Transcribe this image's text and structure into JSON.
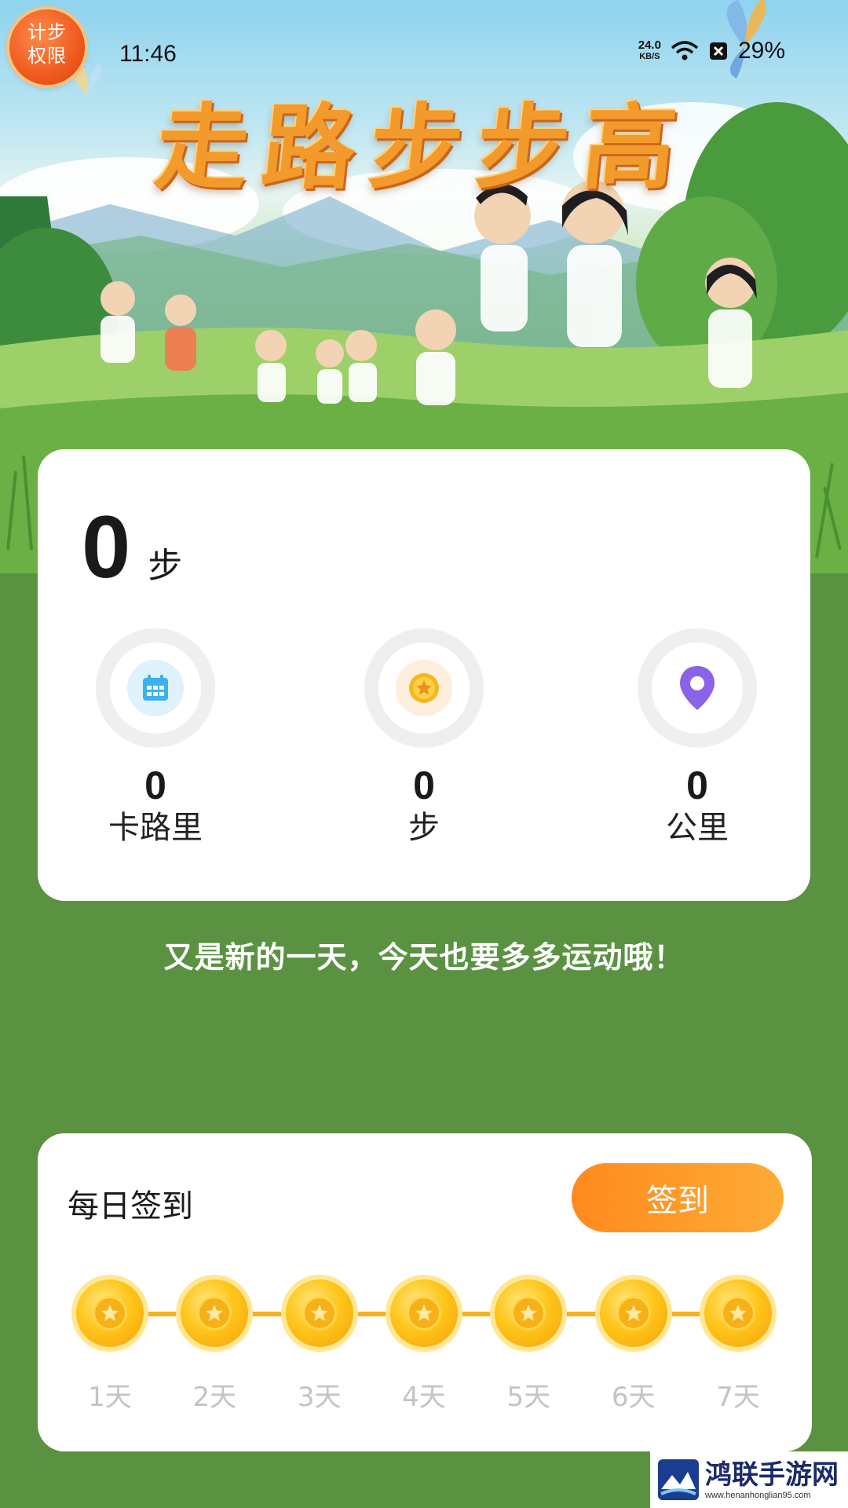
{
  "status_bar": {
    "time": "11:46",
    "net_speed_value": "24.0",
    "net_speed_unit": "KB/S",
    "battery": "29%"
  },
  "permission_badge": {
    "line1": "计步",
    "line2": "权限"
  },
  "hero": {
    "title": "走路步步高"
  },
  "steps_card": {
    "steps_value": "0",
    "steps_unit": "步",
    "stats": [
      {
        "value": "0",
        "label": "卡路里",
        "icon": "calendar-icon"
      },
      {
        "value": "0",
        "label": "步",
        "icon": "coin-icon"
      },
      {
        "value": "0",
        "label": "公里",
        "icon": "location-pin-icon"
      }
    ]
  },
  "motto": "又是新的一天，今天也要多多运动哦！",
  "signin": {
    "title": "每日签到",
    "button_label": "签到",
    "days": [
      "1天",
      "2天",
      "3天",
      "4天",
      "5天",
      "6天",
      "7天"
    ]
  },
  "watermark": {
    "name": "鸿联手游网",
    "url": "www.henanhonglian95.com"
  },
  "colors": {
    "background_green": "#5a9242",
    "accent_orange": "#ff8a1e",
    "title_orange": "#f39a2c",
    "coin_gold": "#ffc51a"
  }
}
